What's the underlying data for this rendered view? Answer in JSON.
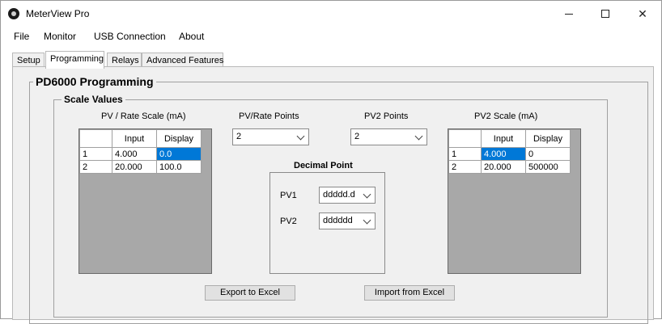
{
  "window": {
    "title": "MeterView Pro",
    "controls": {
      "minimize": "",
      "maximize": "",
      "close": "✕"
    }
  },
  "menu": [
    "File",
    "Monitor",
    "USB Connection",
    "About"
  ],
  "tabs": [
    {
      "label": "Setup",
      "active": false
    },
    {
      "label": "Programming",
      "active": true
    },
    {
      "label": "Relays",
      "active": false
    },
    {
      "label": "Advanced Features",
      "active": false
    }
  ],
  "programming": {
    "group_title": "PD6000 Programming",
    "scale_values": {
      "group_title": "Scale Values",
      "pv_rate_scale": {
        "title": "PV / Rate Scale (mA)",
        "headers": [
          "",
          "Input",
          "Display"
        ],
        "rows": [
          {
            "index": "1",
            "input": "4.000",
            "display": "0.0",
            "selected": "display"
          },
          {
            "index": "2",
            "input": "20.000",
            "display": "100.0"
          }
        ]
      },
      "pv_rate_points": {
        "label": "PV/Rate Points",
        "value": "2"
      },
      "pv2_points": {
        "label": "PV2 Points",
        "value": "2"
      },
      "decimal_point": {
        "title": "Decimal Point",
        "pv1": {
          "label": "PV1",
          "value": "ddddd.d"
        },
        "pv2": {
          "label": "PV2",
          "value": "dddddd"
        }
      },
      "pv2_scale": {
        "title": "PV2 Scale (mA)",
        "headers": [
          "",
          "Input",
          "Display"
        ],
        "rows": [
          {
            "index": "1",
            "input": "4.000",
            "display": "0",
            "selected": "input"
          },
          {
            "index": "2",
            "input": "20.000",
            "display": "500000"
          }
        ]
      }
    },
    "buttons": {
      "export": "Export to Excel",
      "import": "Import from Excel"
    }
  },
  "colors": {
    "selection": "#0078d7",
    "panel": "#f0f0f0",
    "grid_empty": "#a8a8a8"
  }
}
